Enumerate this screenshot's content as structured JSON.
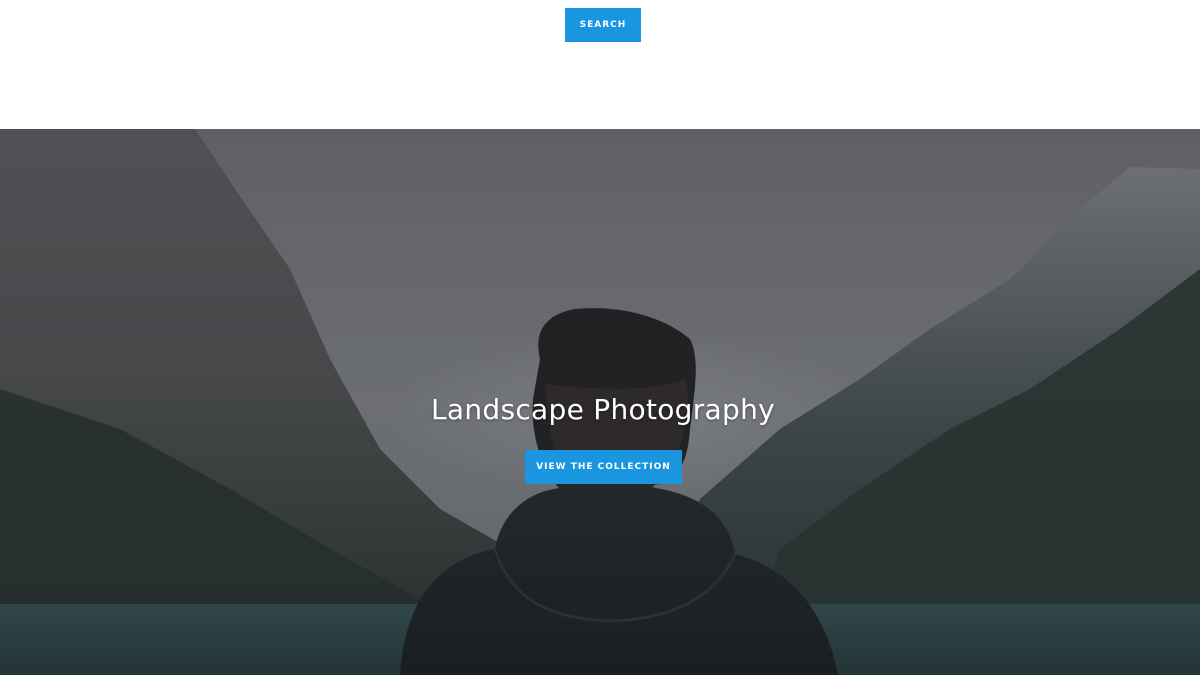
{
  "header": {
    "search_label": "SEARCH"
  },
  "hero": {
    "title": "Landscape Photography",
    "cta_label": "VIEW THE COLLECTION"
  },
  "colors": {
    "accent": "#1a95e0",
    "hero_overlay": "#3a3d40"
  }
}
